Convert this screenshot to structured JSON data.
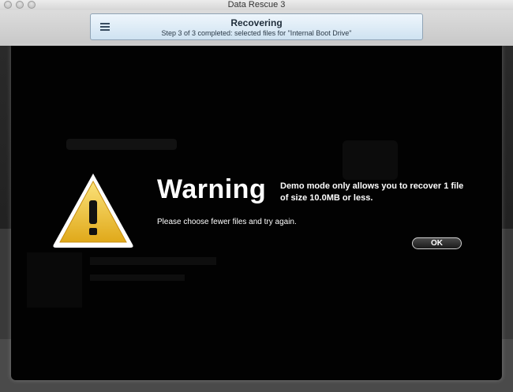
{
  "window": {
    "title": "Data Rescue 3"
  },
  "status": {
    "icon": "list-icon",
    "title": "Recovering",
    "subtitle": "Step 3 of 3 completed: selected files for \"Internal Boot Drive\""
  },
  "dialog": {
    "icon": "warning-icon",
    "heading": "Warning",
    "message": "Demo mode only allows you to recover 1 file of size 10.0MB or less.",
    "submessage": "Please choose fewer files and try again.",
    "ok_label": "OK"
  },
  "colors": {
    "dialog_background": "#020202",
    "warning_fill": "#f2c530",
    "status_panel": "#dbeaf6"
  }
}
